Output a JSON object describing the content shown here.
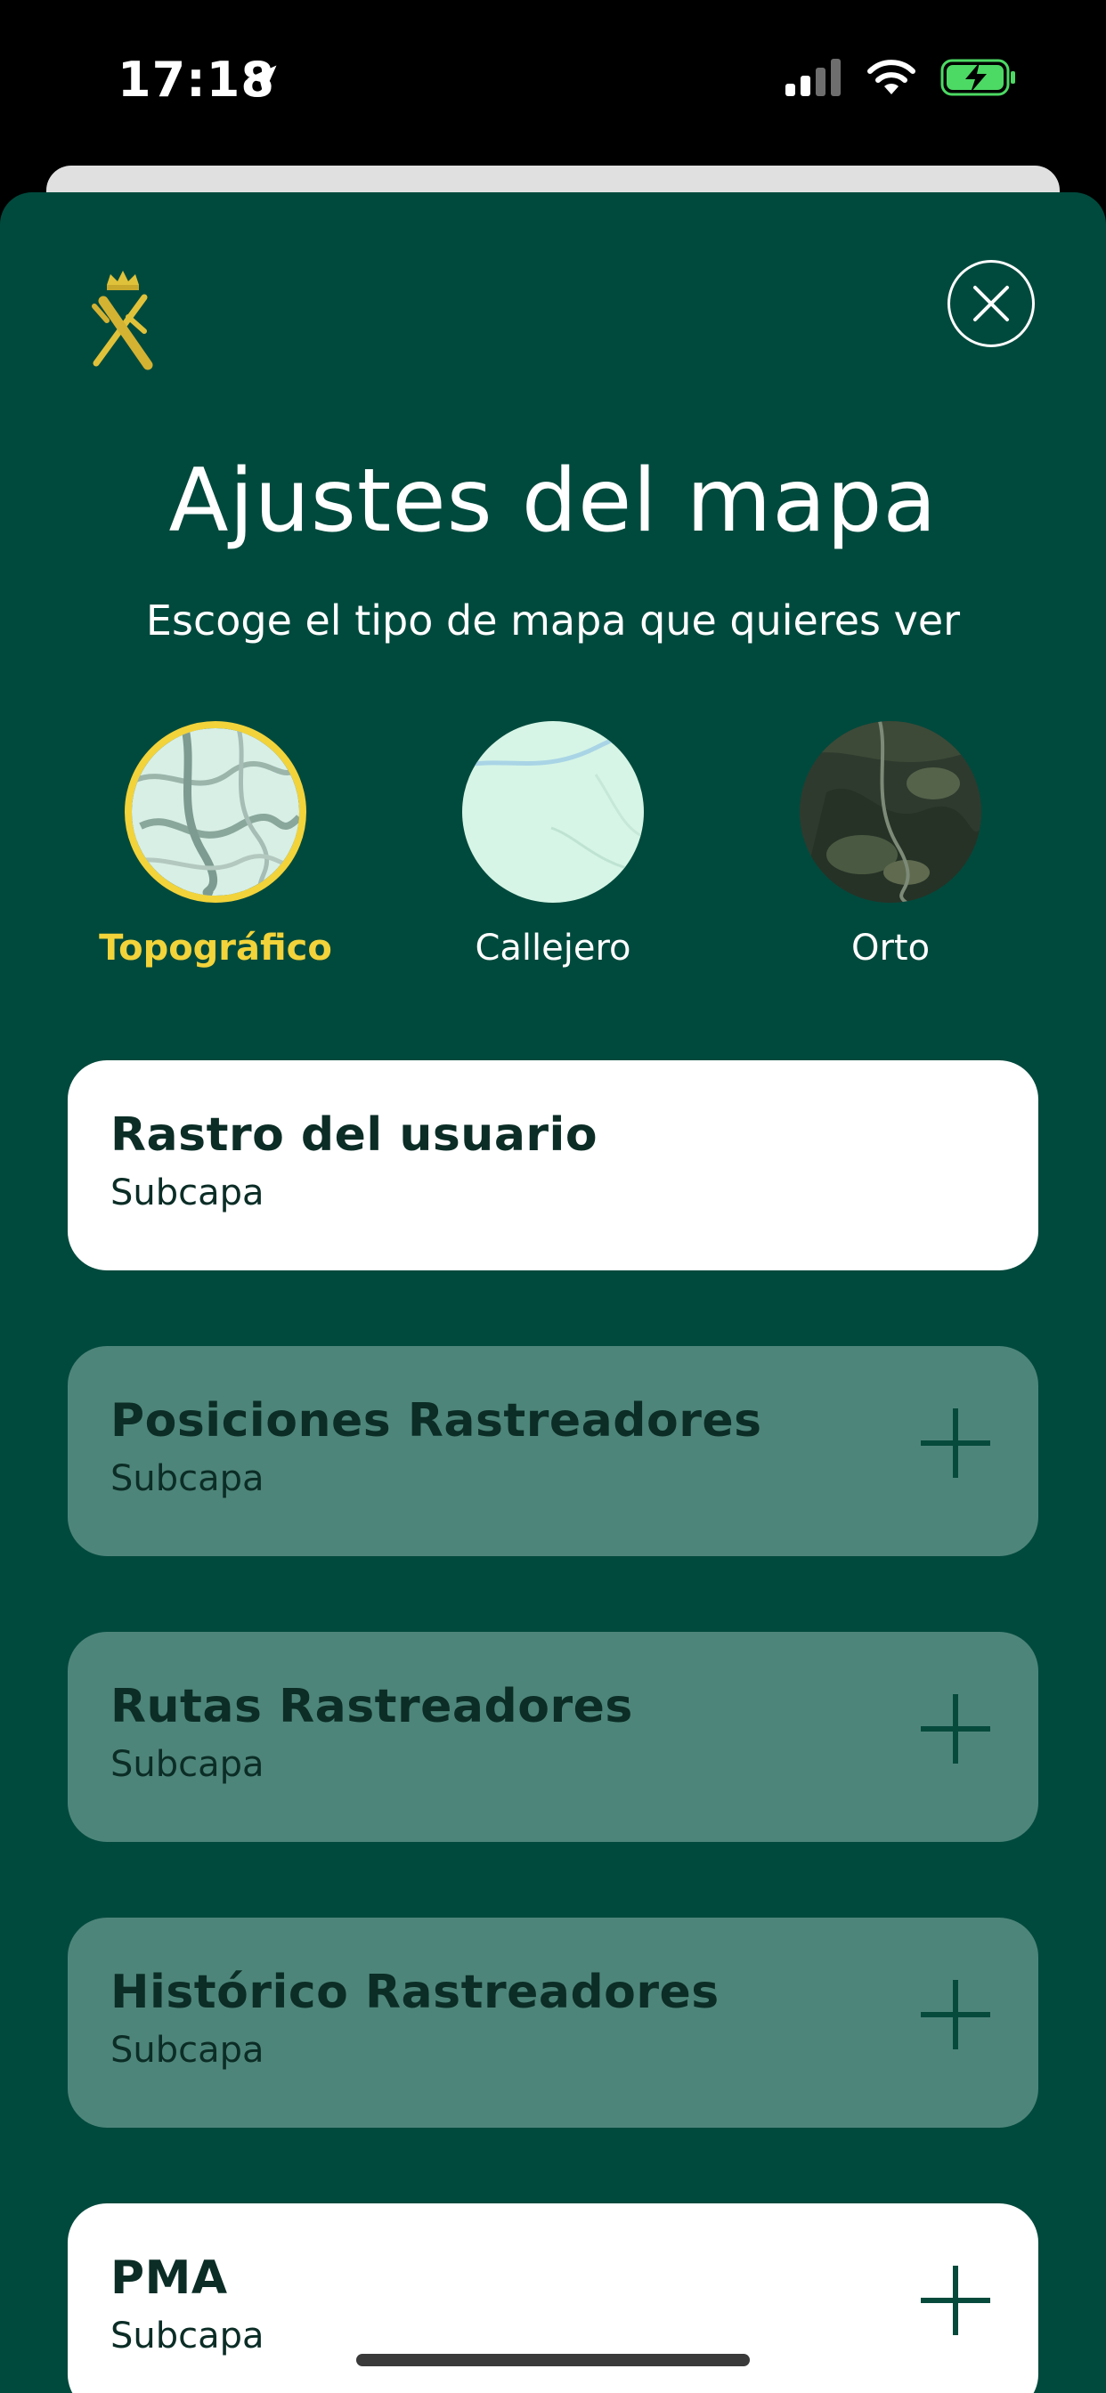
{
  "status_bar": {
    "time": "17:18",
    "icons": [
      "location-arrow-icon",
      "cellular-signal-icon",
      "wifi-icon",
      "battery-charging-icon"
    ]
  },
  "header": {
    "logo_icon": "guardia-civil-emblem-icon",
    "close_icon": "close-icon",
    "title": "Ajustes del mapa",
    "subtitle": "Escoge el tipo de mapa que quieres ver"
  },
  "map_types": [
    {
      "label": "Topográfico",
      "selected": true
    },
    {
      "label": "Callejero",
      "selected": false
    },
    {
      "label": "Orto",
      "selected": false
    }
  ],
  "layers": [
    {
      "title": "Rastro del usuario",
      "subtitle": "Subcapa",
      "active": true,
      "has_add": false
    },
    {
      "title": "Posiciones Rastreadores",
      "subtitle": "Subcapa",
      "active": false,
      "has_add": true
    },
    {
      "title": "Rutas Rastreadores",
      "subtitle": "Subcapa",
      "active": false,
      "has_add": true
    },
    {
      "title": "Histórico Rastreadores",
      "subtitle": "Subcapa",
      "active": false,
      "has_add": true
    },
    {
      "title": "PMA",
      "subtitle": "Subcapa",
      "active": true,
      "has_add": true
    }
  ],
  "colors": {
    "sheet_bg": "#004a3d",
    "accent_yellow": "#f2d33a",
    "active_card": "#ffffff",
    "inactive_card": "#4e857a",
    "dark_text": "#0b2d26"
  }
}
